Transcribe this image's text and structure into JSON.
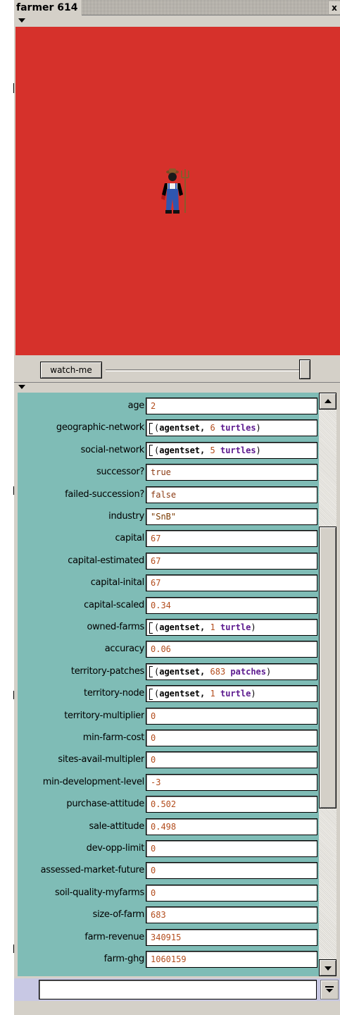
{
  "window": {
    "title": "farmer 614",
    "close_glyph": "x"
  },
  "view": {
    "background_color": "#d6312b",
    "agent_icon": "farmer-with-pitchfork-icon"
  },
  "watch": {
    "button_label": "watch-me"
  },
  "variables": [
    {
      "name": "age",
      "value": "2",
      "kind": "number"
    },
    {
      "name": "geographic-network",
      "kind": "agentset",
      "keyword": "agentset,",
      "count": "6",
      "noun": "turtles"
    },
    {
      "name": "social-network",
      "kind": "agentset",
      "keyword": "agentset,",
      "count": "5",
      "noun": "turtles"
    },
    {
      "name": "successor?",
      "value": "true",
      "kind": "bool"
    },
    {
      "name": "failed-succession?",
      "value": "false",
      "kind": "bool"
    },
    {
      "name": "industry",
      "value": "\"SnB\"",
      "kind": "str"
    },
    {
      "name": "capital",
      "value": "67",
      "kind": "number"
    },
    {
      "name": "capital-estimated",
      "value": "67",
      "kind": "number"
    },
    {
      "name": "capital-inital",
      "value": "67",
      "kind": "number"
    },
    {
      "name": "capital-scaled",
      "value": "0.34",
      "kind": "number"
    },
    {
      "name": "owned-farms",
      "kind": "agentset",
      "keyword": "agentset,",
      "count": "1",
      "noun": "turtle"
    },
    {
      "name": "accuracy",
      "value": "0.06",
      "kind": "number"
    },
    {
      "name": "territory-patches",
      "kind": "agentset",
      "keyword": "agentset,",
      "count": "683",
      "noun": "patches"
    },
    {
      "name": "territory-node",
      "kind": "agentset",
      "keyword": "agentset,",
      "count": "1",
      "noun": "turtle"
    },
    {
      "name": "territory-multiplier",
      "value": "0",
      "kind": "number"
    },
    {
      "name": "min-farm-cost",
      "value": "0",
      "kind": "number"
    },
    {
      "name": "sites-avail-multipler",
      "value": "0",
      "kind": "number"
    },
    {
      "name": "min-development-level",
      "value": "-3",
      "kind": "number"
    },
    {
      "name": "purchase-attitude",
      "value": "0.502",
      "kind": "number"
    },
    {
      "name": "sale-attitude",
      "value": "0.498",
      "kind": "number"
    },
    {
      "name": "dev-opp-limit",
      "value": "0",
      "kind": "number"
    },
    {
      "name": "assessed-market-future",
      "value": "0",
      "kind": "number"
    },
    {
      "name": "soil-quality-myfarms",
      "value": "0",
      "kind": "number"
    },
    {
      "name": "size-of-farm",
      "value": "683",
      "kind": "number"
    },
    {
      "name": "farm-revenue",
      "value": "340915",
      "kind": "number"
    },
    {
      "name": "farm-ghg",
      "value": "1060159",
      "kind": "number"
    }
  ],
  "command": {
    "value": ""
  },
  "colors": {
    "inspector_bg": "#7fbcb6",
    "value_text": "#b34d1d",
    "agentset_noun": "#5c1a8f",
    "command_bar": "#c8c8e4"
  }
}
